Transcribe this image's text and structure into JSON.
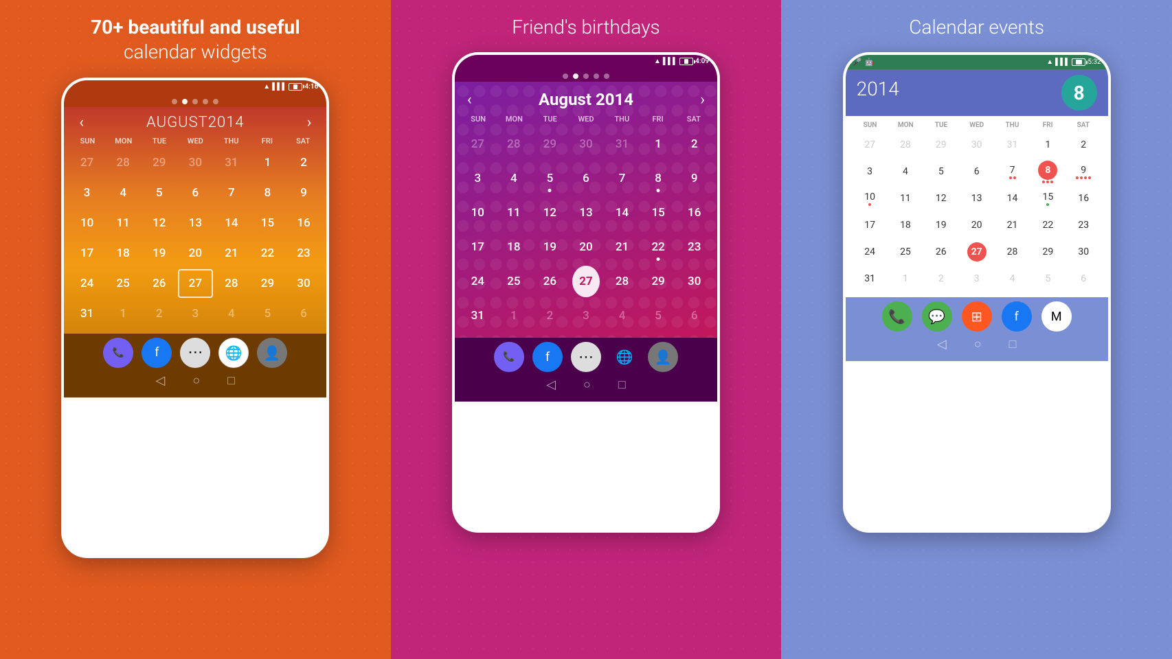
{
  "panel1": {
    "title_line1": "70+ beautiful and useful",
    "title_line2": "calendar widgets",
    "status_time": "4:16",
    "status_battery": "33%",
    "dots": [
      0,
      1,
      2,
      3,
      4
    ],
    "active_dot": 1,
    "month_label": "AUGUST",
    "year_label": "2014",
    "days_header": [
      "SUN",
      "MON",
      "TUE",
      "WED",
      "THU",
      "FRI",
      "SAT"
    ],
    "weeks": [
      [
        "27",
        "28",
        "29",
        "30",
        "31",
        "1",
        "2"
      ],
      [
        "3",
        "4",
        "5",
        "6",
        "7",
        "8",
        "9"
      ],
      [
        "10",
        "11",
        "12",
        "13",
        "14",
        "15",
        "16"
      ],
      [
        "17",
        "18",
        "19",
        "20",
        "21",
        "22",
        "23"
      ],
      [
        "24",
        "25",
        "26",
        "27",
        "28",
        "29",
        "30"
      ],
      [
        "31",
        "1",
        "2",
        "3",
        "4",
        "5",
        "6"
      ]
    ],
    "today_cell": "27",
    "today_week": 4,
    "today_day": 3,
    "nav_prev": "‹",
    "nav_next": "›"
  },
  "panel2": {
    "title": "Friend's birthdays",
    "status_time": "4:09",
    "status_battery": "34%",
    "dots": [
      0,
      1,
      2,
      3,
      4
    ],
    "active_dot": 1,
    "month_label": "August 2014",
    "days_header": [
      "SUN",
      "MON",
      "TUE",
      "WED",
      "THU",
      "FRI",
      "SAT"
    ],
    "weeks": [
      [
        "27",
        "28",
        "29",
        "30",
        "31",
        "1",
        "2"
      ],
      [
        "3",
        "4",
        "5",
        "6",
        "7",
        "8",
        "9"
      ],
      [
        "10",
        "11",
        "12",
        "13",
        "14",
        "15",
        "16"
      ],
      [
        "17",
        "18",
        "19",
        "20",
        "21",
        "22",
        "23"
      ],
      [
        "24",
        "25",
        "26",
        "27",
        "28",
        "29",
        "30"
      ],
      [
        "31",
        "1",
        "2",
        "3",
        "4",
        "5",
        "6"
      ]
    ],
    "today_week": 4,
    "today_day": 3,
    "birthday_cells": [
      [
        3,
        5
      ],
      [
        4,
        2
      ]
    ],
    "nav_prev": "‹",
    "nav_next": "›"
  },
  "panel3": {
    "title": "Calendar events",
    "status_time": "5:32",
    "status_battery": "50%",
    "year": "2014",
    "day_badge": "8",
    "days_header": [
      "SUN",
      "MON",
      "TUE",
      "WED",
      "THU",
      "FRI",
      "SAT"
    ],
    "weeks": [
      [
        "27",
        "28",
        "29",
        "30",
        "31",
        "1",
        "2"
      ],
      [
        "3",
        "4",
        "5",
        "6",
        "7",
        "8",
        "9"
      ],
      [
        "10",
        "11",
        "12",
        "13",
        "14",
        "15",
        "16"
      ],
      [
        "17",
        "18",
        "19",
        "20",
        "21",
        "22",
        "23"
      ],
      [
        "24",
        "25",
        "26",
        "27",
        "28",
        "29",
        "30"
      ],
      [
        "31",
        "1",
        "2",
        "3",
        "4",
        "5",
        "6"
      ]
    ],
    "today_week": 4,
    "today_day": 3,
    "event_dots": {
      "1_5": [
        "#ef5350",
        "#ef5350"
      ],
      "1_6": [
        "#ef5350",
        "#ef5350",
        "#ef5350"
      ],
      "1_7": [
        "#ef5350",
        "#ef5350",
        "#ef5350",
        "#ef5350"
      ],
      "3_5": [
        "#4caf50"
      ],
      "4_3": [
        "#ef5350"
      ]
    }
  },
  "icons": {
    "wifi": "▲",
    "signal": "▌",
    "nav_back": "◁",
    "nav_home": "○",
    "nav_recent": "□"
  }
}
